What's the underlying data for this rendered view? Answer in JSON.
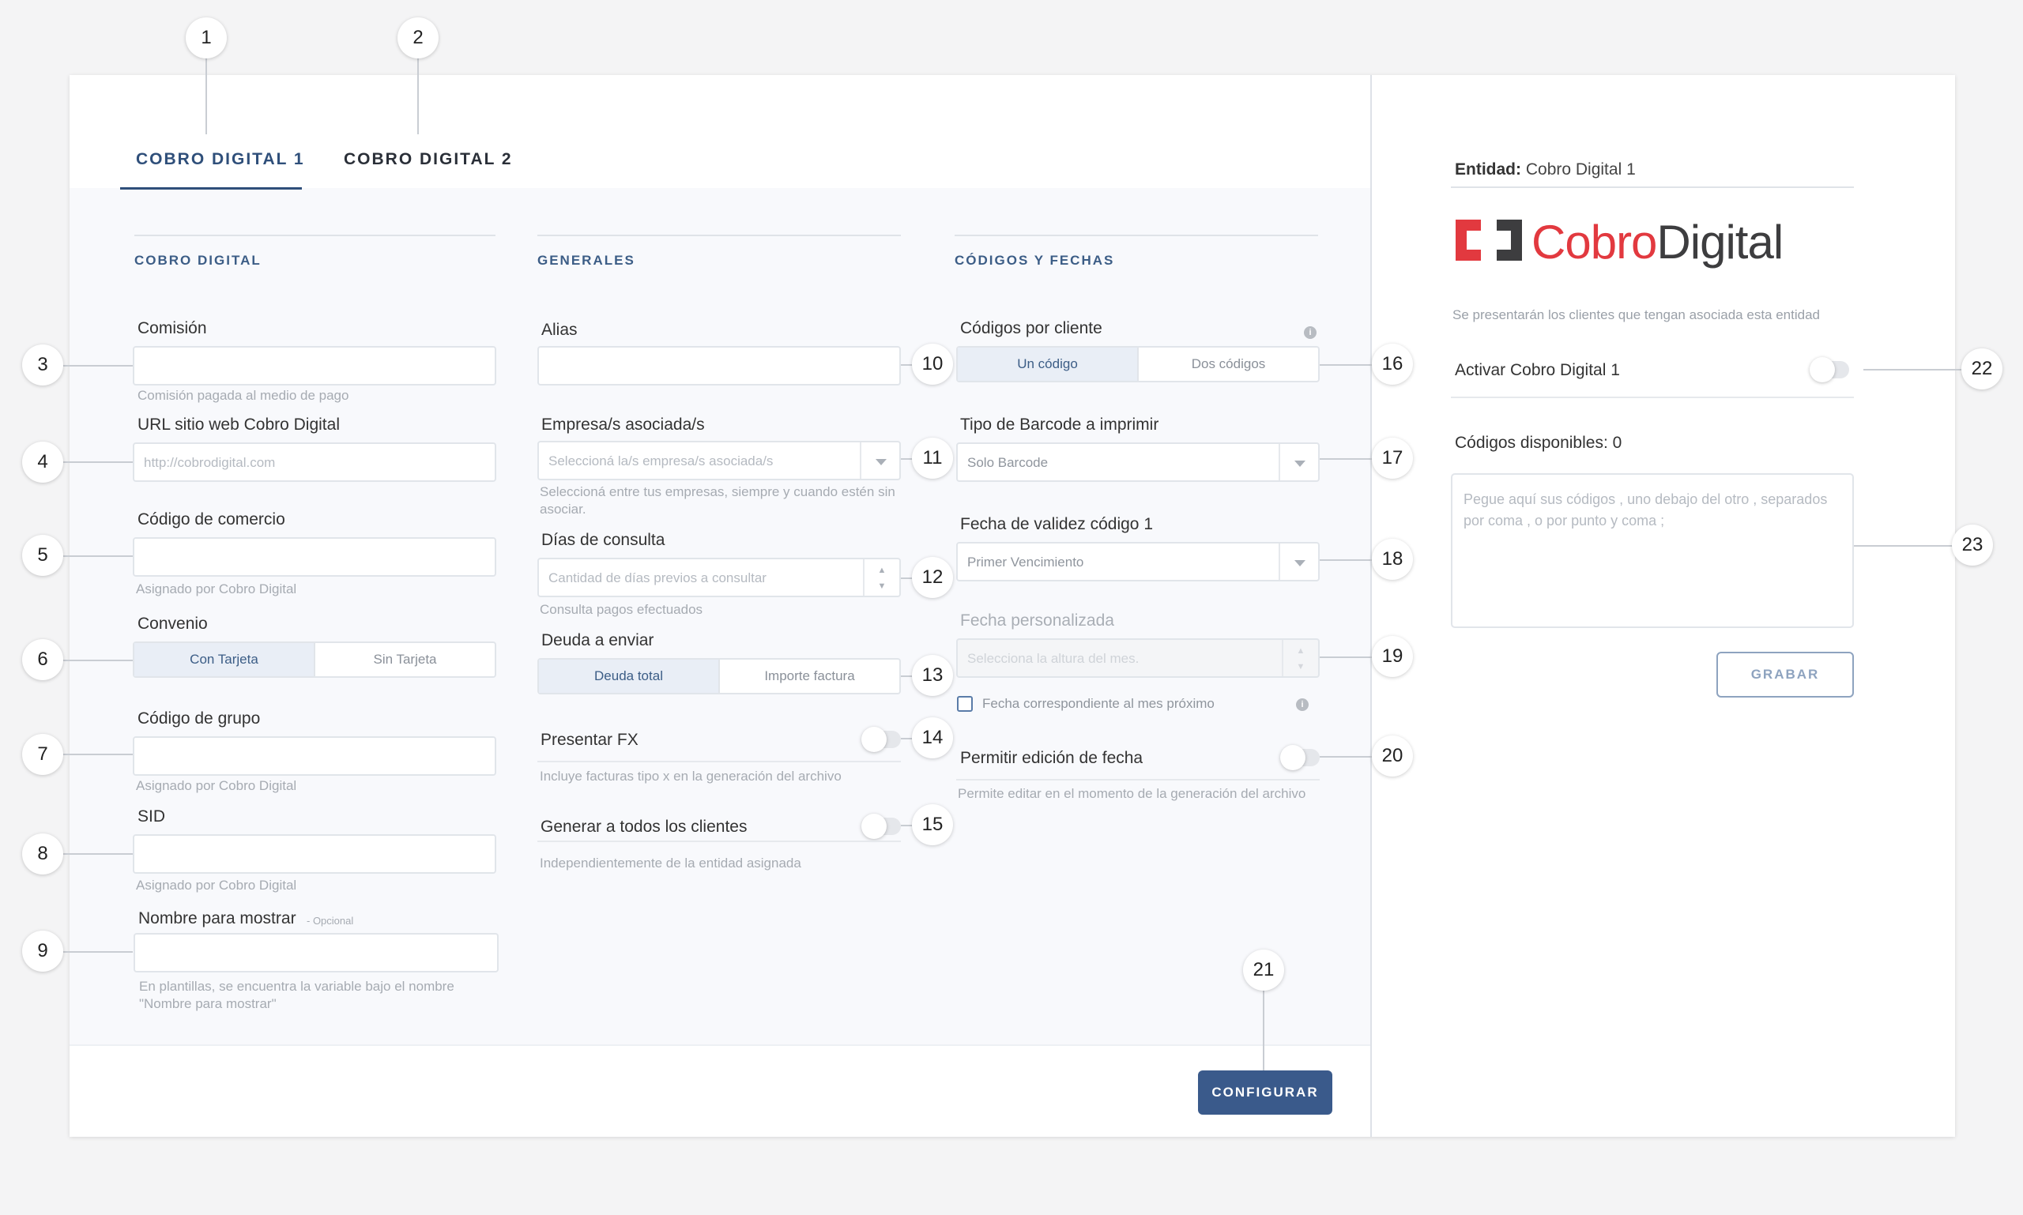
{
  "tabs": [
    {
      "label": "COBRO DIGITAL 1",
      "active": true
    },
    {
      "label": "COBRO DIGITAL 2",
      "active": false
    }
  ],
  "sections": {
    "cobro": "COBRO DIGITAL",
    "generales": "GENERALES",
    "codigos": "CÓDIGOS Y FECHAS"
  },
  "cobro": {
    "comision": {
      "label": "Comisión",
      "value": "",
      "hint": "Comisión pagada al medio de pago"
    },
    "url": {
      "label": "URL sitio web Cobro Digital",
      "placeholder": "http://cobrodigital.com"
    },
    "codigo_comercio": {
      "label": "Código de comercio",
      "value": "",
      "hint": "Asignado por Cobro Digital"
    },
    "convenio": {
      "label": "Convenio",
      "options": [
        "Con Tarjeta",
        "Sin Tarjeta"
      ],
      "selected": "Con Tarjeta"
    },
    "codigo_grupo": {
      "label": "Código de grupo",
      "value": "",
      "hint": "Asignado por Cobro Digital"
    },
    "sid": {
      "label": "SID",
      "value": "",
      "hint": "Asignado por Cobro Digital"
    },
    "nombre": {
      "label": "Nombre para mostrar",
      "optional": "- Opcional",
      "value": "",
      "hint1": "En plantillas, se encuentra la variable bajo el nombre",
      "hint2": "\"Nombre para mostrar\""
    }
  },
  "generales": {
    "alias": {
      "label": "Alias",
      "value": ""
    },
    "empresa": {
      "label": "Empresa/s asociada/s",
      "placeholder": "Seleccioná la/s empresa/s asociada/s",
      "hint1": "Seleccioná entre tus empresas, siempre y cuando estén sin",
      "hint2": "asociar."
    },
    "dias": {
      "label": "Días de consulta",
      "placeholder": "Cantidad de días previos a consultar",
      "hint": "Consulta pagos efectuados"
    },
    "deuda": {
      "label": "Deuda a enviar",
      "options": [
        "Deuda total",
        "Importe factura"
      ],
      "selected": "Deuda total"
    },
    "fx": {
      "label": "Presentar FX",
      "on": false,
      "hint": "Incluye facturas tipo x en la generación del archivo"
    },
    "generar": {
      "label": "Generar a todos los clientes",
      "on": false,
      "hint": "Independientemente de la entidad asignada"
    }
  },
  "codigos": {
    "por_cliente": {
      "label": "Códigos por cliente",
      "options": [
        "Un código",
        "Dos códigos"
      ],
      "selected": "Un código"
    },
    "barcode": {
      "label": "Tipo de Barcode a imprimir",
      "value": "Solo Barcode"
    },
    "validez": {
      "label": "Fecha de validez código 1",
      "value": "Primer Vencimiento"
    },
    "personalizada": {
      "label": "Fecha personalizada",
      "placeholder": "Selecciona la altura del mes."
    },
    "mes_proximo": {
      "label": "Fecha correspondiente al mes próximo",
      "checked": false
    },
    "edicion": {
      "label": "Permitir edición de fecha",
      "on": false,
      "hint": "Permite editar en el momento de la generación del archivo"
    }
  },
  "footer": {
    "configurar": "CONFIGURAR"
  },
  "side": {
    "entidad_label": "Entidad:",
    "entidad_value": "Cobro Digital 1",
    "logo_part1": "Cobro",
    "logo_part2": "Digital",
    "desc": "Se presentarán los clientes que tengan asociada esta entidad",
    "activar": {
      "label": "Activar Cobro Digital 1",
      "on": false
    },
    "disponibles": "Códigos disponibles: 0",
    "textarea_placeholder": "Pegue aquí sus códigos , uno debajo del otro , separados por coma , o por punto y coma ;",
    "grabar": "GRABAR"
  },
  "callouts": [
    "1",
    "2",
    "3",
    "4",
    "5",
    "6",
    "7",
    "8",
    "9",
    "10",
    "11",
    "12",
    "13",
    "14",
    "15",
    "16",
    "17",
    "18",
    "19",
    "20",
    "21",
    "22",
    "23"
  ],
  "colors": {
    "primary": "#3a5a8b",
    "logo_red": "#e2393f",
    "logo_dark": "#3d3d3f"
  }
}
